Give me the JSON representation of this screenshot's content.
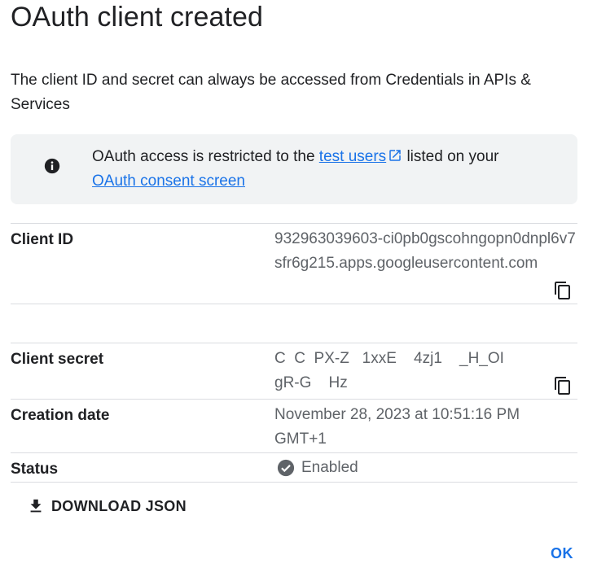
{
  "dialog": {
    "title": "OAuth client created",
    "subtitle": "The client ID and secret can always be accessed from Credentials in APIs & Services"
  },
  "info": {
    "icon": "info-icon",
    "text_before": "OAuth access is restricted to the ",
    "link1": "test users",
    "text_middle": " listed on your",
    "link2": "OAuth consent screen"
  },
  "fields": {
    "client_id": {
      "label": "Client ID",
      "value": "932963039603-ci0pb0gscohngopn0dnpl6v7sfr6g215.apps.googleusercontent.com"
    },
    "client_secret": {
      "label": "Client secret",
      "value": "C  C  PX-Z   1xxE    4zj1    _H_OI    gR-G    Hz"
    },
    "creation_date": {
      "label": "Creation date",
      "value": "November 28, 2023 at 10:51:16 PM GMT+1"
    },
    "status": {
      "label": "Status",
      "value": "Enabled"
    }
  },
  "actions": {
    "download_label": "DOWNLOAD JSON",
    "ok_label": "OK"
  },
  "colors": {
    "link": "#1a73e8",
    "info_bg": "#f1f3f4",
    "value_text": "#5f6368"
  }
}
